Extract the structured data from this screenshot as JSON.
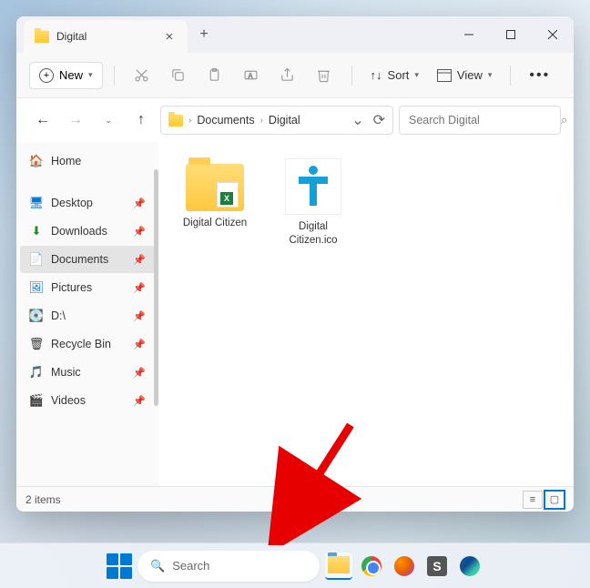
{
  "tab": {
    "title": "Digital"
  },
  "toolbar": {
    "new_label": "New",
    "sort_label": "Sort",
    "view_label": "View"
  },
  "breadcrumb": {
    "items": [
      "Documents",
      "Digital"
    ]
  },
  "search": {
    "placeholder": "Search Digital"
  },
  "sidebar": {
    "home": "Home",
    "items": [
      {
        "label": "Desktop"
      },
      {
        "label": "Downloads"
      },
      {
        "label": "Documents"
      },
      {
        "label": "Pictures"
      },
      {
        "label": "D:\\"
      },
      {
        "label": "Recycle Bin"
      },
      {
        "label": "Music"
      },
      {
        "label": "Videos"
      }
    ]
  },
  "files": [
    {
      "name": "Digital Citizen"
    },
    {
      "name": "Digital Citizen.ico"
    }
  ],
  "status": {
    "text": "2 items"
  },
  "taskbar": {
    "search_label": "Search"
  }
}
